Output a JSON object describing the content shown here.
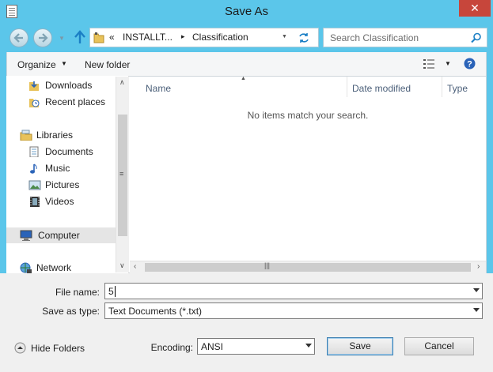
{
  "window": {
    "title": "Save As",
    "close_glyph": "✕"
  },
  "address": {
    "overflow_glyph": "«",
    "crumbs": [
      "INSTALLT...",
      "Classification"
    ],
    "separator_glyph": "▸"
  },
  "search": {
    "placeholder": "Search Classification"
  },
  "toolbar": {
    "organize_label": "Organize",
    "new_folder_label": "New folder"
  },
  "nav": {
    "items": [
      {
        "label": "Downloads",
        "icon": "downloads-folder-icon"
      },
      {
        "label": "Recent places",
        "icon": "recent-places-icon"
      },
      {
        "label": "Libraries",
        "icon": "libraries-icon"
      },
      {
        "label": "Documents",
        "icon": "documents-icon"
      },
      {
        "label": "Music",
        "icon": "music-icon"
      },
      {
        "label": "Pictures",
        "icon": "pictures-icon"
      },
      {
        "label": "Videos",
        "icon": "videos-icon"
      },
      {
        "label": "Computer",
        "icon": "computer-icon"
      },
      {
        "label": "Network",
        "icon": "network-icon"
      }
    ]
  },
  "filelist": {
    "columns": [
      "Name",
      "Date modified",
      "Type"
    ],
    "empty_message": "No items match your search."
  },
  "form": {
    "file_name_label": "File name:",
    "file_name_value": "5",
    "save_type_label": "Save as type:",
    "save_type_value": "Text Documents (*.txt)",
    "encoding_label": "Encoding:",
    "encoding_value": "ANSI",
    "hide_folders_label": "Hide Folders",
    "save_label": "Save",
    "cancel_label": "Cancel"
  },
  "colors": {
    "titlebar": "#5bc6ea",
    "close": "#c7463b",
    "header_text": "#4c607a"
  }
}
